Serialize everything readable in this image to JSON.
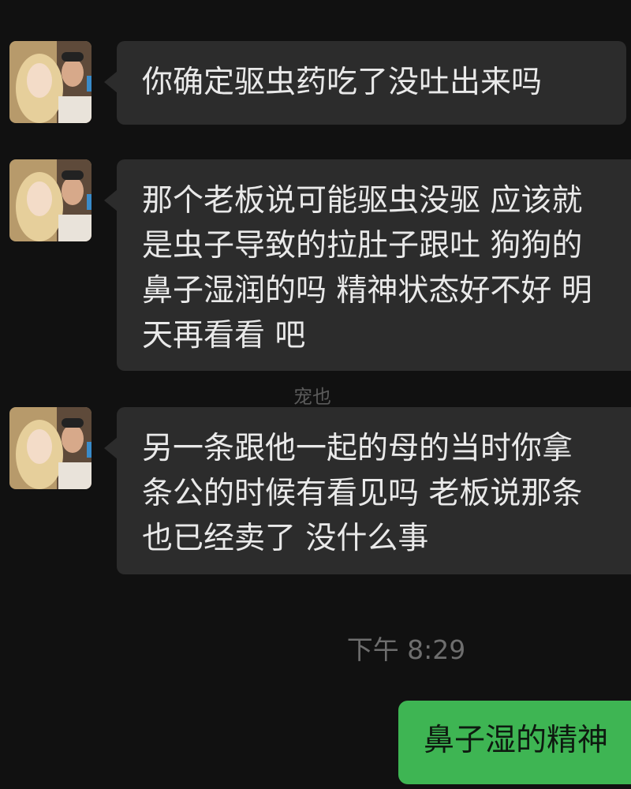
{
  "messages_in": [
    {
      "sender": "contact",
      "lines": [
        "你确定驱虫药吃了没吐出来吗"
      ]
    },
    {
      "sender": "contact",
      "lines": [
        "那个老板说可能驱虫没驱  应该就",
        "是虫子导致的拉肚子跟吐 狗狗的",
        "鼻子湿润的吗 精神状态好不好 明",
        "天再看看 吧"
      ]
    },
    {
      "sender": "contact",
      "lines": [
        "另一条跟他一起的母的当时你拿",
        "条公的时候有看见吗 老板说那条",
        "也已经卖了 没什么事"
      ]
    }
  ],
  "watermark": "宠也",
  "timestamp": "下午 8:29",
  "message_out": {
    "sender": "me",
    "text": "鼻子湿的精神"
  },
  "colors": {
    "background": "#111111",
    "incoming_bubble": "#2c2c2c",
    "outgoing_bubble": "#3eb553",
    "incoming_text": "#e9e9e9",
    "timestamp_text": "#6e6e6e"
  }
}
